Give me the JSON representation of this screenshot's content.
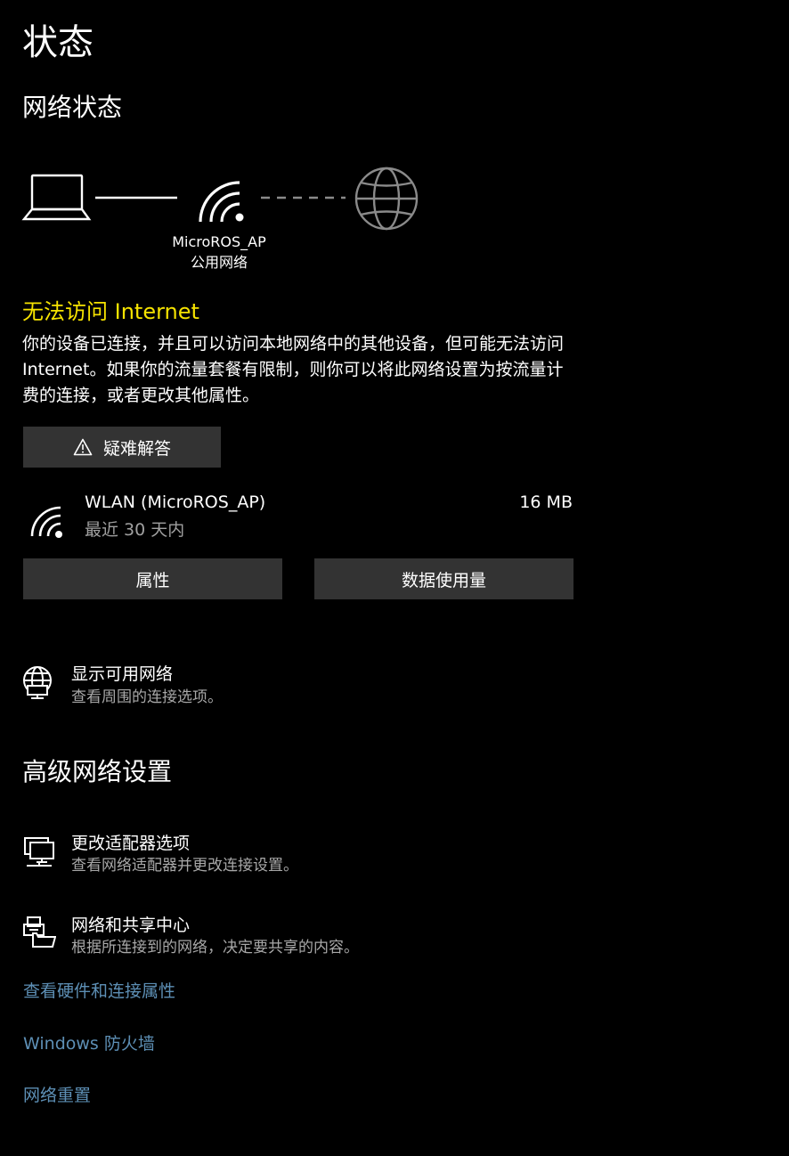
{
  "page_title": "状态",
  "network_status": {
    "heading": "网络状态",
    "network_name": "MicroROS_AP",
    "network_type": "公用网络",
    "diagram_icons": [
      "laptop-icon",
      "wifi-signal-icon",
      "globe-icon"
    ]
  },
  "connection_status": {
    "heading": "无法访问 Internet",
    "description": "你的设备已连接，并且可以访问本地网络中的其他设备，但可能无法访问 Internet。如果你的流量套餐有限制，则你可以将此网络设置为按流量计费的连接，或者更改其他属性。",
    "color": "#f6e300"
  },
  "troubleshoot_button": {
    "label": "疑难解答",
    "icon": "warning-icon"
  },
  "connection": {
    "name": "WLAN (MicroROS_AP)",
    "period": "最近 30 天内",
    "usage": "16 MB",
    "icon": "wifi-icon"
  },
  "buttons": {
    "properties": "属性",
    "data_usage": "数据使用量"
  },
  "show_networks": {
    "title": "显示可用网络",
    "subtitle": "查看周围的连接选项。",
    "icon": "globe-network-icon"
  },
  "advanced": {
    "heading": "高级网络设置",
    "adapter_options": {
      "title": "更改适配器选项",
      "subtitle": "查看网络适配器并更改连接设置。",
      "icon": "adapter-icon"
    },
    "sharing_center": {
      "title": "网络和共享中心",
      "subtitle": "根据所连接到的网络，决定要共享的内容。",
      "icon": "sharing-center-icon"
    }
  },
  "links": {
    "hardware_properties": "查看硬件和连接属性",
    "firewall": "Windows 防火墙",
    "network_reset": "网络重置"
  },
  "colors": {
    "background": "#000000",
    "button_bg": "#333333",
    "link": "#5d8fb5",
    "secondary_text": "#a0a0a0"
  }
}
